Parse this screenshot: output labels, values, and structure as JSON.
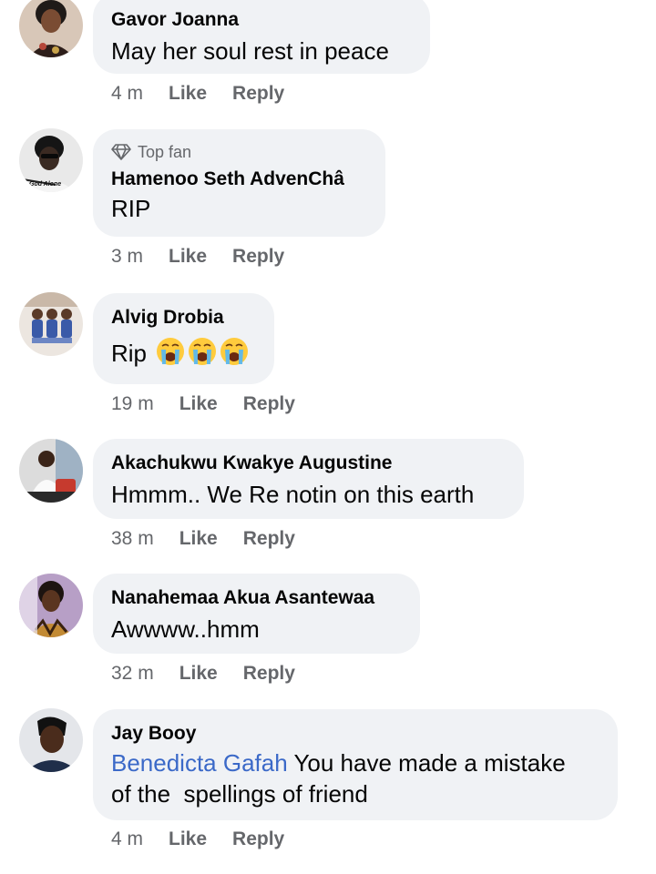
{
  "comments": [
    {
      "name": "Gavor Joanna",
      "text": "May her soul rest in peace",
      "time": "4 m",
      "like": "Like",
      "reply": "Reply"
    },
    {
      "badge": "Top fan",
      "name": "Hamenoo Seth AdvenChâ",
      "text": "RIP",
      "time": "3 m",
      "like": "Like",
      "reply": "Reply",
      "avatar_caption": "God Alone"
    },
    {
      "name": "Alvig Drobia",
      "text": "Rip",
      "emoji_icon": "loudly-crying-face",
      "time": "19 m",
      "like": "Like",
      "reply": "Reply"
    },
    {
      "name": "Akachukwu Kwakye Augustine",
      "text": "Hmmm.. We Re notin on this earth",
      "time": "38 m",
      "like": "Like",
      "reply": "Reply"
    },
    {
      "name": "Nanahemaa Akua Asantewaa",
      "text": "Awwww..hmm",
      "time": "32 m",
      "like": "Like",
      "reply": "Reply"
    },
    {
      "name": "Jay Booy",
      "mention": "Benedicta Gafah",
      "text_line1": " You have made a mistake",
      "text_line2": "of the  spellings of friend",
      "time": "4 m",
      "like": "Like",
      "reply": "Reply"
    }
  ],
  "colors": {
    "bubble": "#f0f2f5",
    "meta": "#65676b",
    "mention": "#3b69c8"
  }
}
